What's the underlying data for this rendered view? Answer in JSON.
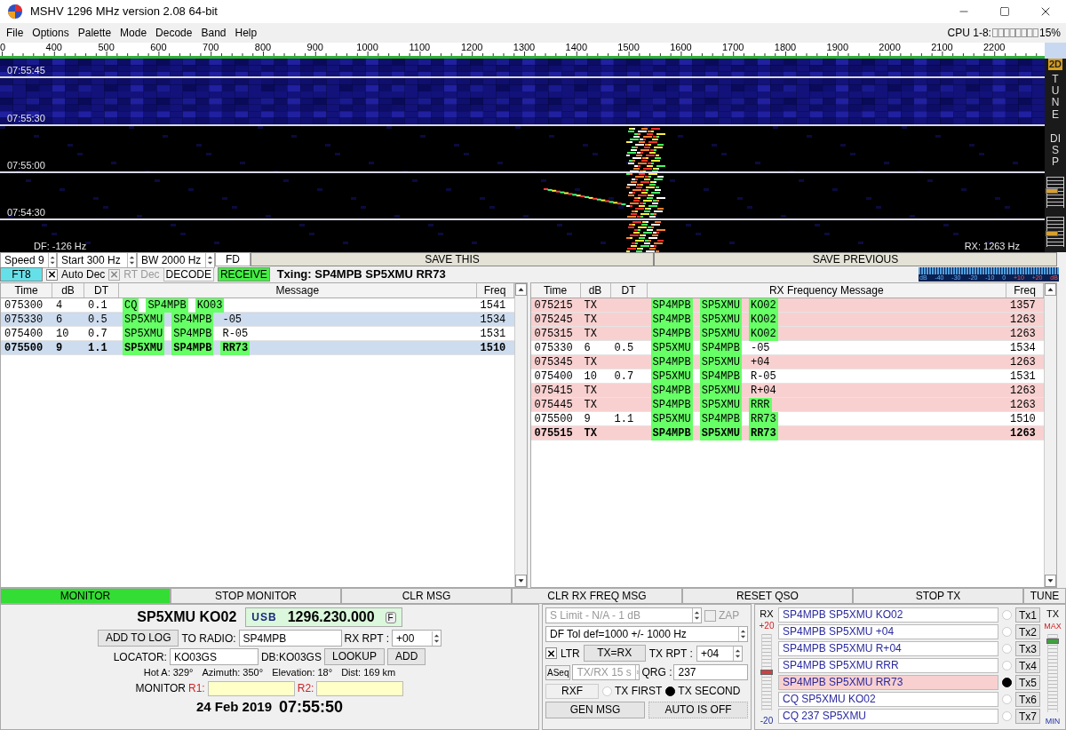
{
  "window": {
    "title": "MSHV 1296 MHz version 2.08 64-bit"
  },
  "menu": [
    "File",
    "Options",
    "Palette",
    "Mode",
    "Decode",
    "Band",
    "Help"
  ],
  "cpu": {
    "label": "CPU 1-8:",
    "value": "15%"
  },
  "scale": {
    "ticks": [
      "0",
      "400",
      "500",
      "600",
      "700",
      "800",
      "900",
      "1000",
      "1100",
      "1200",
      "1300",
      "1400",
      "1500",
      "1600",
      "1700",
      "1800",
      "1900",
      "2000",
      "2100",
      "2200"
    ]
  },
  "waterfall": {
    "times": [
      "07:55:45",
      "07:55:30",
      "07:55:00",
      "07:54:30"
    ],
    "df": "DF: -126 Hz",
    "rx": "RX: 1263 Hz"
  },
  "side": {
    "mode": "2D",
    "tune": "TUNE",
    "disp": "DISP",
    "sliders": [
      {
        "level": 0.55
      },
      {
        "level": 0.45
      }
    ]
  },
  "controls": {
    "speed": "Speed 9",
    "start": "Start 300 Hz",
    "bw": "BW 2000 Hz",
    "fd": "FD",
    "save_this": "SAVE THIS",
    "save_previous": "SAVE PREVIOUS"
  },
  "decode_bar": {
    "mode": "FT8",
    "auto_dec": {
      "label": "Auto Dec",
      "checked": true
    },
    "rt_dec": {
      "label": "RT Dec",
      "checked": true,
      "disabled": true
    },
    "decode": "DECODE",
    "receive": "RECEIVE",
    "txing": "Txing: SP4MPB SP5XMU RR73",
    "meter_labels": [
      "dB",
      "-40",
      "-30",
      "-20",
      "-10",
      "0",
      "+10",
      "+20",
      "dB"
    ]
  },
  "band_activity": {
    "columns": [
      "Time",
      "dB",
      "DT",
      "Message",
      "Freq"
    ],
    "rows": [
      {
        "time": "075300",
        "db": "4",
        "dt": "0.1",
        "message": [
          {
            "text": "CQ",
            "highlight": true
          },
          {
            "text": "SP4MPB",
            "highlight": true
          },
          {
            "text": "KO03",
            "highlight": true
          }
        ],
        "freq": "1541",
        "selected": false,
        "latest": false
      },
      {
        "time": "075330",
        "db": "6",
        "dt": "0.5",
        "message": [
          {
            "text": "SP5XMU",
            "highlight": true
          },
          {
            "text": "SP4MPB",
            "highlight": true
          },
          {
            "text": "-05",
            "highlight": false
          }
        ],
        "freq": "1534",
        "selected": true,
        "latest": false
      },
      {
        "time": "075400",
        "db": "10",
        "dt": "0.7",
        "message": [
          {
            "text": "SP5XMU",
            "highlight": true
          },
          {
            "text": "SP4MPB",
            "highlight": true
          },
          {
            "text": "R-05",
            "highlight": false
          }
        ],
        "freq": "1531",
        "selected": false,
        "latest": false
      },
      {
        "time": "075500",
        "db": "9",
        "dt": "1.1",
        "message": [
          {
            "text": "SP5XMU",
            "highlight": true
          },
          {
            "text": "SP4MPB",
            "highlight": true
          },
          {
            "text": "RR73",
            "highlight": true
          }
        ],
        "freq": "1510",
        "selected": true,
        "latest": true
      }
    ]
  },
  "rx_frequency": {
    "columns": [
      "Time",
      "dB",
      "DT",
      "RX Frequency Message",
      "Freq"
    ],
    "rows": [
      {
        "kind": "tx",
        "time": "075215",
        "db": "TX",
        "message": [
          {
            "text": "SP4MPB",
            "highlight": true
          },
          {
            "text": "SP5XMU",
            "highlight": true
          },
          {
            "text": "KO02",
            "highlight": true
          }
        ],
        "freq": "1357",
        "latest": false
      },
      {
        "kind": "tx",
        "time": "075245",
        "db": "TX",
        "message": [
          {
            "text": "SP4MPB",
            "highlight": true
          },
          {
            "text": "SP5XMU",
            "highlight": true
          },
          {
            "text": "KO02",
            "highlight": true
          }
        ],
        "freq": "1263",
        "latest": false
      },
      {
        "kind": "tx",
        "time": "075315",
        "db": "TX",
        "message": [
          {
            "text": "SP4MPB",
            "highlight": true
          },
          {
            "text": "SP5XMU",
            "highlight": true
          },
          {
            "text": "KO02",
            "highlight": true
          }
        ],
        "freq": "1263",
        "latest": false
      },
      {
        "kind": "rx",
        "time": "075330",
        "db": "6",
        "dt": "0.5",
        "message": [
          {
            "text": "SP5XMU",
            "highlight": true
          },
          {
            "text": "SP4MPB",
            "highlight": true
          },
          {
            "text": "-05",
            "highlight": false
          }
        ],
        "freq": "1534",
        "latest": false
      },
      {
        "kind": "tx",
        "time": "075345",
        "db": "TX",
        "message": [
          {
            "text": "SP4MPB",
            "highlight": true
          },
          {
            "text": "SP5XMU",
            "highlight": true
          },
          {
            "text": "+04",
            "highlight": false
          }
        ],
        "freq": "1263",
        "latest": false
      },
      {
        "kind": "rx",
        "time": "075400",
        "db": "10",
        "dt": "0.7",
        "message": [
          {
            "text": "SP5XMU",
            "highlight": true
          },
          {
            "text": "SP4MPB",
            "highlight": true
          },
          {
            "text": "R-05",
            "highlight": false
          }
        ],
        "freq": "1531",
        "latest": false
      },
      {
        "kind": "tx",
        "time": "075415",
        "db": "TX",
        "message": [
          {
            "text": "SP4MPB",
            "highlight": true
          },
          {
            "text": "SP5XMU",
            "highlight": true
          },
          {
            "text": "R+04",
            "highlight": false
          }
        ],
        "freq": "1263",
        "latest": false
      },
      {
        "kind": "tx",
        "time": "075445",
        "db": "TX",
        "message": [
          {
            "text": "SP4MPB",
            "highlight": true
          },
          {
            "text": "SP5XMU",
            "highlight": true
          },
          {
            "text": "RRR",
            "highlight": true
          }
        ],
        "freq": "1263",
        "latest": false
      },
      {
        "kind": "rx",
        "time": "075500",
        "db": "9",
        "dt": "1.1",
        "message": [
          {
            "text": "SP5XMU",
            "highlight": true
          },
          {
            "text": "SP4MPB",
            "highlight": true
          },
          {
            "text": "RR73",
            "highlight": true
          }
        ],
        "freq": "1510",
        "latest": false
      },
      {
        "kind": "tx",
        "time": "075515",
        "db": "TX",
        "message": [
          {
            "text": "SP4MPB",
            "highlight": true
          },
          {
            "text": "SP5XMU",
            "highlight": true
          },
          {
            "text": "RR73",
            "highlight": true
          }
        ],
        "freq": "1263",
        "latest": true
      }
    ]
  },
  "buttons": [
    {
      "label": "MONITOR",
      "on": true
    },
    {
      "label": "STOP MONITOR",
      "on": false
    },
    {
      "label": "CLR MSG",
      "on": false
    },
    {
      "label": "CLR RX FREQ MSG",
      "on": false
    },
    {
      "label": "RESET QSO",
      "on": false
    },
    {
      "label": "STOP TX",
      "on": false
    },
    {
      "label": "TUNE",
      "on": false
    }
  ],
  "station": {
    "call": "SP5XMU KO02",
    "mode": "USB",
    "frequency": "1296.230.000",
    "f_button": "F",
    "add_to_log": "ADD TO LOG",
    "to_radio_label": "TO RADIO:",
    "to_radio": "SP4MPB",
    "rx_rpt_label": "RX RPT :",
    "rx_rpt": "+00",
    "locator_label": "LOCATOR:",
    "locator": "KO03GS",
    "db_locator": "DB:KO03GS",
    "lookup": "LOOKUP",
    "add": "ADD",
    "geo": [
      "Hot A: 329°",
      "Azimuth: 350°",
      "Elevation: 18°",
      "Dist: 169 km"
    ],
    "monitor_label": "MONITOR",
    "r1": "R1:",
    "r2": "R2:",
    "date": "24 Feb 2019",
    "time": "07:55:50"
  },
  "options": {
    "s_limit": "S Limit - N/A - 1  dB",
    "zap": {
      "label": "ZAP",
      "checked": false,
      "disabled": true
    },
    "df_tol": "DF Tol def=1000 +/-  1000  Hz",
    "ltr": {
      "label": "LTR",
      "checked": true
    },
    "tx_eq_rx": "TX=RX",
    "tx_rpt_label": "TX RPT :",
    "tx_rpt": "+04",
    "aseq": "ASeq",
    "tx_rx": "TX/RX 15  s",
    "qrg_label": "QRG :",
    "qrg": "237",
    "rxf": "RXF",
    "tx_order": [
      {
        "label": "TX FIRST",
        "selected": false
      },
      {
        "label": "TX SECOND",
        "selected": true
      }
    ],
    "gen_msg": "GEN MSG",
    "auto": "AUTO IS OFF"
  },
  "tx_messages": {
    "rx_label": "RX",
    "rx_max": "+20",
    "rx_min": "-20",
    "rx_gain": {
      "level": 0.5
    },
    "tx_label": "TX",
    "tx_max": "MAX",
    "tx_min": "MIN",
    "tx_power": {
      "level": 0.9
    },
    "items": [
      {
        "text": "SP4MPB SP5XMU KO02",
        "button": "Tx1",
        "selected": false
      },
      {
        "text": "SP4MPB SP5XMU +04",
        "button": "Tx2",
        "selected": false
      },
      {
        "text": "SP4MPB SP5XMU R+04",
        "button": "Tx3",
        "selected": false
      },
      {
        "text": "SP4MPB SP5XMU RRR",
        "button": "Tx4",
        "selected": false
      },
      {
        "text": "SP4MPB SP5XMU RR73",
        "button": "Tx5",
        "selected": true
      },
      {
        "text": "CQ SP5XMU KO02",
        "button": "Tx6",
        "selected": false
      },
      {
        "text": "CQ 237 SP5XMU",
        "button": "Tx7",
        "selected": false
      }
    ]
  }
}
